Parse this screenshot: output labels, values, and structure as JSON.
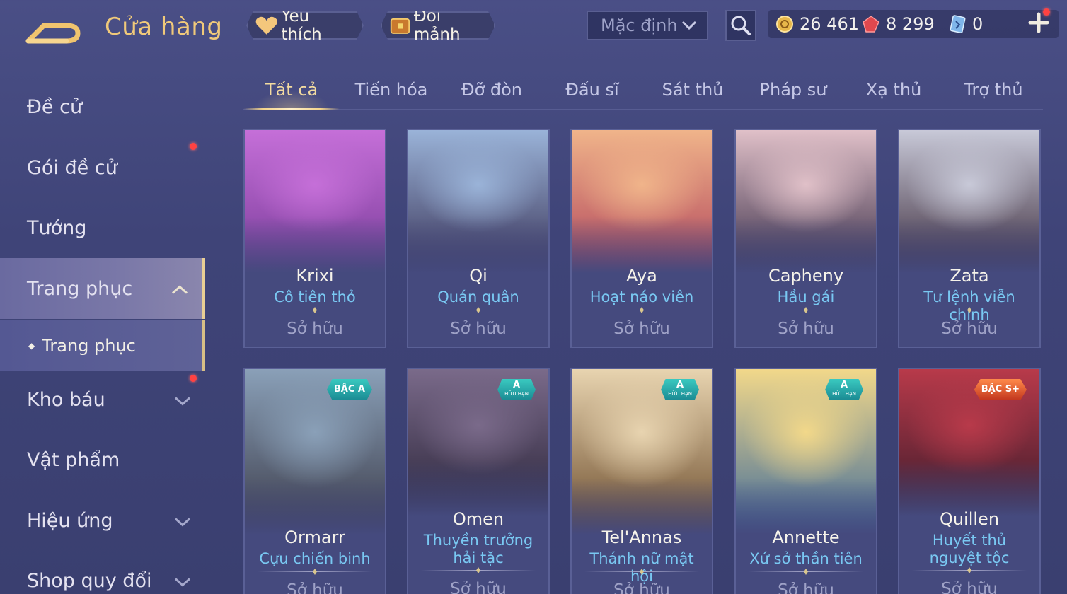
{
  "header": {
    "title": "Cửa hàng",
    "favorite_label": "Yêu thích",
    "exchange_label": "Đổi mảnh",
    "sort_value": "Mặc định",
    "gold": "26 461",
    "ruby": "8 299",
    "voucher": "0"
  },
  "sidebar": {
    "items": [
      {
        "label": "Đề cử"
      },
      {
        "label": "Gói đề cử"
      },
      {
        "label": "Tướng"
      },
      {
        "label": "Trang phục"
      },
      {
        "label": "Kho báu"
      },
      {
        "label": "Vật phẩm"
      },
      {
        "label": "Hiệu ứng"
      },
      {
        "label": "Shop quy đổi"
      }
    ],
    "sub_item": "Trang phục"
  },
  "tabs": [
    "Tất cả",
    "Tiến hóa",
    "Đỡ đòn",
    "Đấu sĩ",
    "Sát thủ",
    "Pháp sư",
    "Xạ thủ",
    "Trợ thủ"
  ],
  "cards": [
    {
      "hero": "Krixi",
      "skin": "Cô tiên thỏ",
      "status": "Sở hữu",
      "colors": [
        "#c56fd8",
        "#7a3c9a"
      ]
    },
    {
      "hero": "Qi",
      "skin": "Quán quân",
      "status": "Sở hữu",
      "colors": [
        "#9ab3d8",
        "#3a3458"
      ]
    },
    {
      "hero": "Aya",
      "skin": "Hoạt náo viên",
      "status": "Sở hữu",
      "colors": [
        "#f0b48a",
        "#b0435a"
      ]
    },
    {
      "hero": "Capheny",
      "skin": "Hầu gái",
      "status": "Sở hữu",
      "colors": [
        "#e0c0c8",
        "#3a2e48"
      ]
    },
    {
      "hero": "Zata",
      "skin": "Tư lệnh viễn chinh",
      "status": "Sở hữu",
      "colors": [
        "#c8c9d8",
        "#3b2a3a"
      ]
    },
    {
      "hero": "Ormarr",
      "skin": "Cựu chiến binh",
      "status": "Sở hữu",
      "badge": "BẬC A",
      "badge_sub": "",
      "colors": [
        "#8aa0b8",
        "#3a3a48"
      ]
    },
    {
      "hero": "Omen",
      "skin": "Thuyền trưởng hải tặc",
      "status": "Sở hữu",
      "badge": "A",
      "badge_sub": "HỮU HẠN",
      "colors": [
        "#7a6a8a",
        "#2a2438"
      ]
    },
    {
      "hero": "Tel'Annas",
      "skin": "Thánh nữ mật hội",
      "status": "Sở hữu",
      "badge": "A",
      "badge_sub": "HỮU HẠN",
      "colors": [
        "#e8d4b0",
        "#6a4a2a"
      ]
    },
    {
      "hero": "Annette",
      "skin": "Xứ sở thần tiên",
      "status": "Sở hữu",
      "badge": "A",
      "badge_sub": "HỮU HẠN",
      "colors": [
        "#f2d88a",
        "#3e6a9a"
      ]
    },
    {
      "hero": "Quillen",
      "skin": "Huyết thủ nguyệt tộc",
      "status": "Sở hữu",
      "badge": "BẬC S+",
      "badge_sub": "",
      "colors": [
        "#b83a4a",
        "#3a1a2a"
      ]
    }
  ]
}
